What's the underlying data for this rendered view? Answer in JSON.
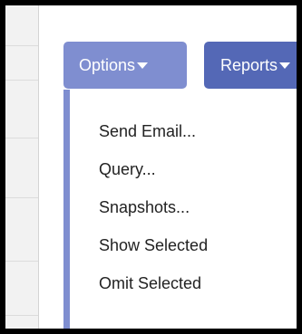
{
  "toolbar": {
    "options_label": "Options",
    "reports_label": "Reports"
  },
  "options_menu": {
    "items": [
      {
        "label": "Send Email..."
      },
      {
        "label": "Query..."
      },
      {
        "label": "Snapshots..."
      },
      {
        "label": "Show Selected"
      },
      {
        "label": "Omit Selected"
      }
    ]
  },
  "colors": {
    "options_button": "#7f8ed0",
    "reports_button": "#5468b6",
    "menu_accent": "#7f8ed0",
    "outer_border": "#000000"
  }
}
